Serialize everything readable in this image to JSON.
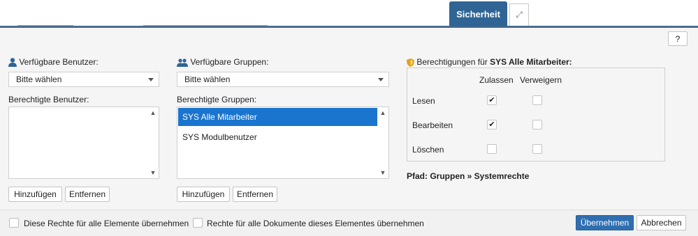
{
  "tabs": {
    "active_label": "Sicherheit",
    "expand_icon": "expand-arrows-icon"
  },
  "help": {
    "label": "?"
  },
  "users": {
    "available_label": "Verfügbare Benutzer:",
    "icon": "user-icon",
    "select_value": "Bitte wählen",
    "authorized_label": "Berechtigte Benutzer:",
    "items": [],
    "add_label": "Hinzufügen",
    "remove_label": "Entfernen"
  },
  "groups": {
    "available_label": "Verfügbare Gruppen:",
    "icon": "group-icon",
    "select_value": "Bitte wählen",
    "authorized_label": "Berechtigte Gruppen:",
    "items": [
      "SYS Alle Mitarbeiter",
      "SYS Modulbenutzer"
    ],
    "selected_item": "SYS Alle Mitarbeiter",
    "add_label": "Hinzufügen",
    "remove_label": "Entfernen"
  },
  "permissions": {
    "title_prefix": "Berechtigungen für ",
    "title_subject": "SYS Alle Mitarbeiter:",
    "icon": "shield-icon",
    "columns": [
      "Zulassen",
      "Verweigern"
    ],
    "rows": [
      {
        "label": "Lesen",
        "allow": true,
        "deny": false
      },
      {
        "label": "Bearbeiten",
        "allow": true,
        "deny": false
      },
      {
        "label": "Löschen",
        "allow": false,
        "deny": false
      }
    ],
    "path": "Pfad: Gruppen » Systemrechte"
  },
  "footer": {
    "apply_all_elements": "Diese Rechte für alle Elemente übernehmen",
    "apply_all_documents": "Rechte für alle Dokumente dieses Elementes übernehmen",
    "apply_label": "Übernehmen",
    "cancel_label": "Abbrechen"
  },
  "colors": {
    "tab_active": "#2f6495",
    "selected_row": "#1a75cf",
    "primary_button": "#2f6fb0",
    "shield": "#e0a21a"
  }
}
